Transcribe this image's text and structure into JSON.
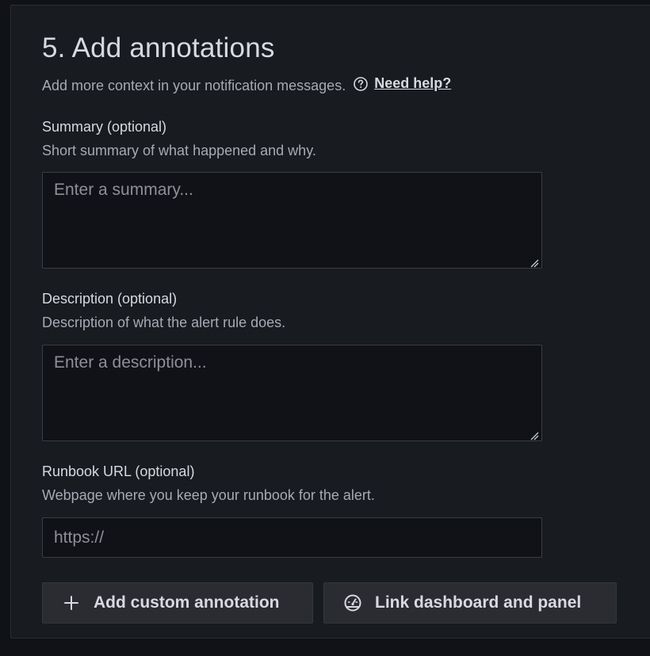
{
  "section": {
    "title": "5. Add annotations",
    "subtitle": "Add more context in your notification messages.",
    "help_label": "Need help?",
    "help_icon": "question-circle-icon"
  },
  "fields": {
    "summary": {
      "label": "Summary (optional)",
      "description": "Short summary of what happened and why.",
      "placeholder": "Enter a summary...",
      "value": ""
    },
    "description": {
      "label": "Description (optional)",
      "description": "Description of what the alert rule does.",
      "placeholder": "Enter a description...",
      "value": ""
    },
    "runbook": {
      "label": "Runbook URL (optional)",
      "description": "Webpage where you keep your runbook for the alert.",
      "placeholder": "https://",
      "value": ""
    }
  },
  "actions": {
    "add_custom": {
      "label": "Add custom annotation",
      "icon": "plus-icon"
    },
    "link_dashboard": {
      "label": "Link dashboard and panel",
      "icon": "dashboard-gauge-icon"
    }
  }
}
